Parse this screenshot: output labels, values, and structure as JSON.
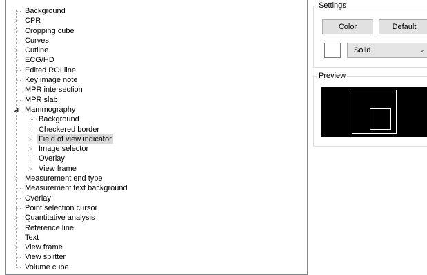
{
  "tree": {
    "items": [
      {
        "label": "Background",
        "level": 0,
        "expander": "none"
      },
      {
        "label": "CPR",
        "level": 0,
        "expander": "collapsed"
      },
      {
        "label": "Cropping cube",
        "level": 0,
        "expander": "collapsed"
      },
      {
        "label": "Curves",
        "level": 0,
        "expander": "none"
      },
      {
        "label": "Cutline",
        "level": 0,
        "expander": "collapsed"
      },
      {
        "label": "ECG/HD",
        "level": 0,
        "expander": "collapsed"
      },
      {
        "label": "Edited ROI line",
        "level": 0,
        "expander": "none"
      },
      {
        "label": "Key image note",
        "level": 0,
        "expander": "none"
      },
      {
        "label": "MPR intersection",
        "level": 0,
        "expander": "none"
      },
      {
        "label": "MPR slab",
        "level": 0,
        "expander": "none"
      },
      {
        "label": "Mammography",
        "level": 0,
        "expander": "expanded"
      },
      {
        "label": "Background",
        "level": 1,
        "expander": "none"
      },
      {
        "label": "Checkered border",
        "level": 1,
        "expander": "none"
      },
      {
        "label": "Field of view indicator",
        "level": 1,
        "expander": "collapsed",
        "selected": true
      },
      {
        "label": "Image selector",
        "level": 1,
        "expander": "collapsed"
      },
      {
        "label": "Overlay",
        "level": 1,
        "expander": "none"
      },
      {
        "label": "View frame",
        "level": 1,
        "expander": "collapsed"
      },
      {
        "label": "Measurement end type",
        "level": 0,
        "expander": "collapsed"
      },
      {
        "label": "Measurement text background",
        "level": 0,
        "expander": "none"
      },
      {
        "label": "Overlay",
        "level": 0,
        "expander": "none"
      },
      {
        "label": "Point selection cursor",
        "level": 0,
        "expander": "none"
      },
      {
        "label": "Quantitative analysis",
        "level": 0,
        "expander": "collapsed"
      },
      {
        "label": "Reference line",
        "level": 0,
        "expander": "collapsed"
      },
      {
        "label": "Text",
        "level": 0,
        "expander": "none"
      },
      {
        "label": "View frame",
        "level": 0,
        "expander": "collapsed"
      },
      {
        "label": "View splitter",
        "level": 0,
        "expander": "none"
      },
      {
        "label": "Volume cube",
        "level": 0,
        "expander": "none"
      }
    ]
  },
  "settings": {
    "title": "Settings",
    "color_label": "Color",
    "default_label": "Default",
    "swatch_color": "#ffffff",
    "line_style": "Solid"
  },
  "preview": {
    "title": "Preview",
    "background_color": "#000000",
    "frame_color": "#ffffff"
  }
}
